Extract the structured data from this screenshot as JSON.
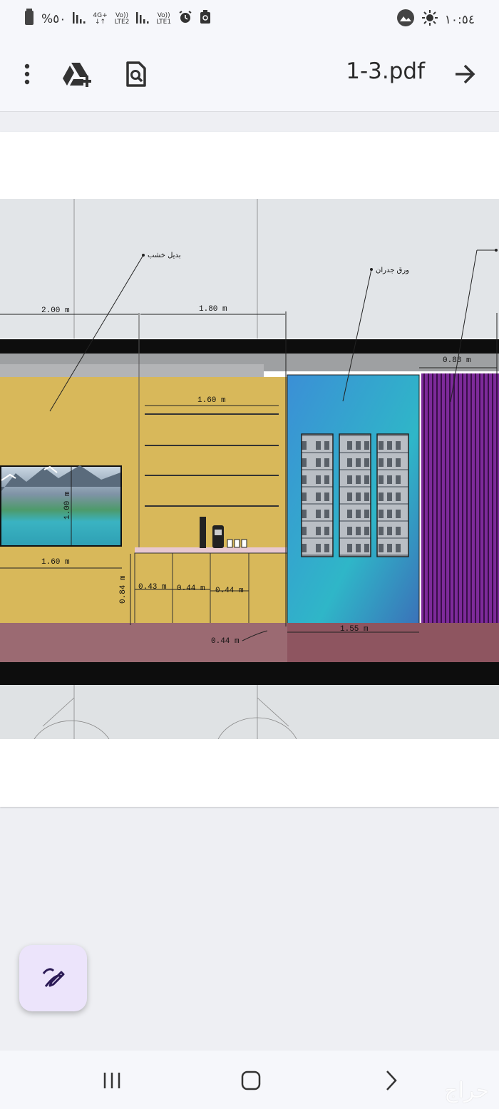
{
  "status_bar": {
    "battery": "%٥٠",
    "network1": "4G+",
    "network2_top": "Vo))",
    "network2_bottom": "LTE2",
    "network3_top": "Vo))",
    "network3_bottom": "LTE1",
    "time": "١٠:٥٤"
  },
  "toolbar": {
    "file_name": "1-3.pdf",
    "icons": [
      "more-vert-icon",
      "drive-add-icon",
      "find-in-page-icon",
      "arrow-forward-icon"
    ]
  },
  "drawing": {
    "label_wood": "بديل خشب",
    "label_wallpaper": "ورق جدران",
    "dim_2_00": "2.00 m",
    "dim_1_80": "1.80 m",
    "dim_0_88": "0.88 m",
    "dim_1_60_top": "1.60 m",
    "dim_1_00": "1.00 m",
    "dim_1_60_bottom": "1.60 m",
    "dim_0_84": "0.84 m",
    "dim_0_43": "0.43 m",
    "dim_0_44_a": "0.44 m",
    "dim_0_44_b": "0.44 m",
    "dim_0_44_c": "0.44 m",
    "dim_1_55": "1.55 m"
  },
  "fab": {
    "icon": "edit-pen-icon"
  },
  "navbar": {
    "icons": [
      "recents-icon",
      "home-icon",
      "back-icon"
    ]
  },
  "watermark": "حراج",
  "colors": {
    "accent_fab": "#ece4fb",
    "wall_yellow": "#d8b85a",
    "purple_panel": "#8a2aa0"
  }
}
